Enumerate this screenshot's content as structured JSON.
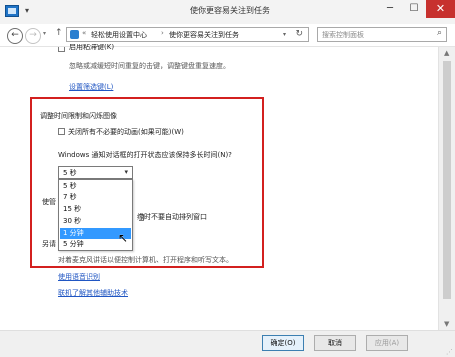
{
  "window": {
    "title": "使你更容易关注到任务",
    "min_glyph": "─",
    "max_glyph": "☐",
    "close_glyph": "✕"
  },
  "quick_access": {
    "arrow_glyph": "▾"
  },
  "nav": {
    "back_glyph": "←",
    "forward_glyph": "→",
    "dropdown_glyph": "▾",
    "up_glyph": "↑"
  },
  "address": {
    "prefix_sep": "«",
    "crumb1": "轻松使用设置中心",
    "sep": "›",
    "crumb2": "使你更容易关注到任务",
    "dropdown_glyph": "▾",
    "refresh_glyph": "↻"
  },
  "search": {
    "placeholder": "搜索控制面板",
    "icon_glyph": "⌕"
  },
  "content": {
    "top_cut_checkbox_label": "启用粘滞键(K)",
    "sticky_desc": "忽略或减缓短时间重复的击键，调整键盘重复速度。",
    "filter_keys_link": "设置筛选键(L)",
    "section_title": "调整时间限制和闪烁图像",
    "animations_checkbox": "关闭所有不必要的动画(如果可能)(W)",
    "notify_question": "Windows 通知对话框的打开状态应该保持多长时间(N)?",
    "selected_value": "5 秒",
    "select_arrow": "▾",
    "options": [
      "5 秒",
      "7 秒",
      "15 秒",
      "30 秒",
      "1 分钟",
      "5 分钟"
    ],
    "highlighted_option_index": 4,
    "partial_left_1": "使管",
    "partial_right_1": "缘时不要自动排列窗口",
    "partial_left_2": "另请",
    "speech_desc": "对着麦克风讲话以便控制计算机、打开程序和听写文本。",
    "speech_link": "使用语音识别",
    "assistive_link": "联机了解其他辅助技术"
  },
  "buttons": {
    "ok": "确定(O)",
    "cancel": "取消",
    "apply": "应用(A)"
  },
  "scrollbar": {
    "up_glyph": "▲",
    "down_glyph": "▼",
    "thumb_fraction": 0.88
  },
  "colors": {
    "highlight_border": "#d3201f",
    "close_button": "#c7312e",
    "link": "#2056c3",
    "selection": "#3399ff"
  }
}
